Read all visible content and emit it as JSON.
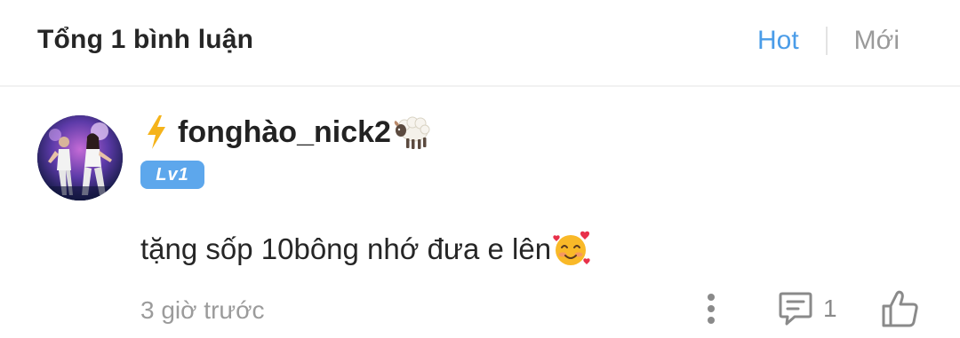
{
  "header": {
    "title": "Tổng 1 bình luận",
    "sort_tabs": [
      {
        "label": "Hot",
        "active": true
      },
      {
        "label": "Mới",
        "active": false
      }
    ]
  },
  "comment": {
    "username": "fonghào_nick2",
    "name_prefix_icon": "lightning-bolt-icon",
    "name_suffix_icon": "sheep-emoji-icon",
    "level": "Lv1",
    "text": "tặng sốp 10bông nhớ đưa e lên",
    "text_emoji_icon": "smiling-face-with-hearts-icon",
    "timestamp": "3 giờ trước",
    "reply_count": "1"
  },
  "colors": {
    "accent": "#4a9ce8",
    "level_badge": "#5da7ec",
    "muted": "#9b9b9b",
    "bolt": "#f5b31a"
  }
}
